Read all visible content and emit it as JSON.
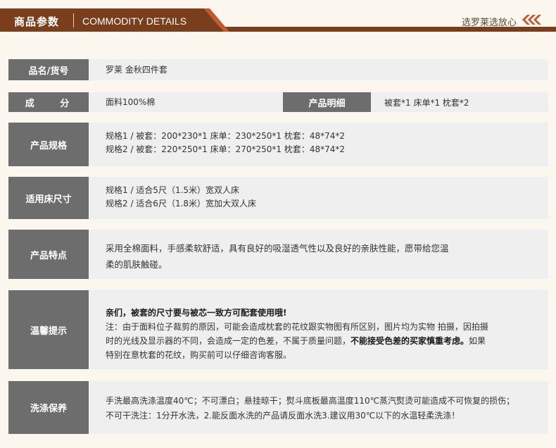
{
  "header": {
    "title_cn": "商品参数",
    "title_en": "COMMODITY DETAILS",
    "slogan": "选罗莱选放心",
    "brand_color": "#7a3e1c",
    "accent_color": "#c4582e"
  },
  "rows": {
    "name": {
      "label": "品名/货号",
      "value": "罗莱 金秋四件套"
    },
    "composition": {
      "label": "成  分",
      "value": "面料100%棉",
      "detail_label": "产品明细",
      "detail_value": "被套*1 床单*1 枕套*2"
    },
    "spec": {
      "label": "产品规格",
      "lines": [
        "规格1 / 被套：200*230*1 床单：230*250*1 枕套：48*74*2",
        "规格2 / 被套：220*250*1 床单：270*250*1 枕套：48*74*2"
      ]
    },
    "bed_size": {
      "label": "适用床尺寸",
      "lines": [
        "规格1 / 适合5尺（1.5米）宽双人床",
        "规格2 / 适合6尺（1.8米）宽加大双人床"
      ]
    },
    "features": {
      "label": "产品特点",
      "lines": [
        "采用全棉面料，手感柔软舒适，具有良好的吸湿透气性以及良好的亲肤性能，愿带给您温",
        "柔的肌肤触碰。"
      ]
    },
    "tips": {
      "label": "温馨提示",
      "bold_line": "亲们，被套的尺寸要与被芯一致方可配套使用哦!",
      "lines": [
        "注：由于面料位子裁剪的原因，可能会造成枕套的花纹跟实物图有所区别，图片均为实物 拍摄，因拍摄",
        "时的光线及显示器的不同，会造成一定的色差，不属于质量问题，",
        "特别在意枕套的花纹，购买前可以仔细咨询客服。"
      ],
      "emphasis": "不能接受色差的买家慎重考虑。",
      "line2_tail": "如果"
    },
    "washing": {
      "label": "洗涤保养",
      "lines": [
        "手洗最高洗涤温度40℃；不可漂白；悬挂晾干；熨斗底板最高温度110℃蒸汽熨烫可能造成不可恢复的损伤；",
        "不可干洗注：1分开水洗，2.能反面水洗的产品请反面水洗3.建议用30℃以下的水温轻柔洗涤！"
      ]
    }
  }
}
